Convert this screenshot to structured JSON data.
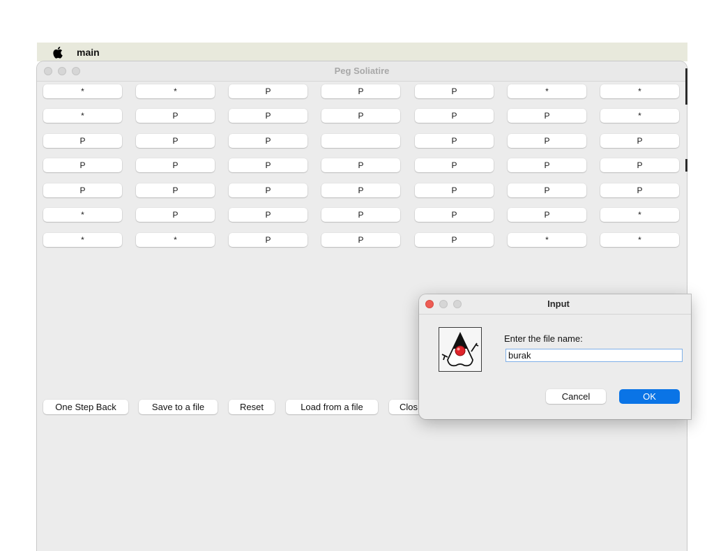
{
  "menubar": {
    "app_name": "main",
    "apple_icon": "apple-logo-icon"
  },
  "window": {
    "title": "Peg Soliatire",
    "board": [
      [
        "*",
        "*",
        "P",
        "P",
        "P",
        "*",
        "*"
      ],
      [
        "*",
        "P",
        "P",
        "P",
        "P",
        "P",
        "*"
      ],
      [
        "P",
        "P",
        "P",
        "",
        "P",
        "P",
        "P"
      ],
      [
        "P",
        "P",
        "P",
        "P",
        "P",
        "P",
        "P"
      ],
      [
        "P",
        "P",
        "P",
        "P",
        "P",
        "P",
        "P"
      ],
      [
        "*",
        "P",
        "P",
        "P",
        "P",
        "P",
        "*"
      ],
      [
        "*",
        "*",
        "P",
        "P",
        "P",
        "*",
        "*"
      ]
    ],
    "buttons": {
      "one_step_back": "One Step Back",
      "save_to_file": "Save to a file",
      "reset": "Reset",
      "load_from_file": "Load from a file",
      "close": "Clos"
    }
  },
  "dialog": {
    "title": "Input",
    "icon": "java-duke-icon",
    "prompt": "Enter the file name:",
    "input_value": "burak",
    "cancel_label": "Cancel",
    "ok_label": "OK",
    "colors": {
      "close_traffic": "#ee5d55",
      "ok_button": "#0a74e6"
    }
  }
}
